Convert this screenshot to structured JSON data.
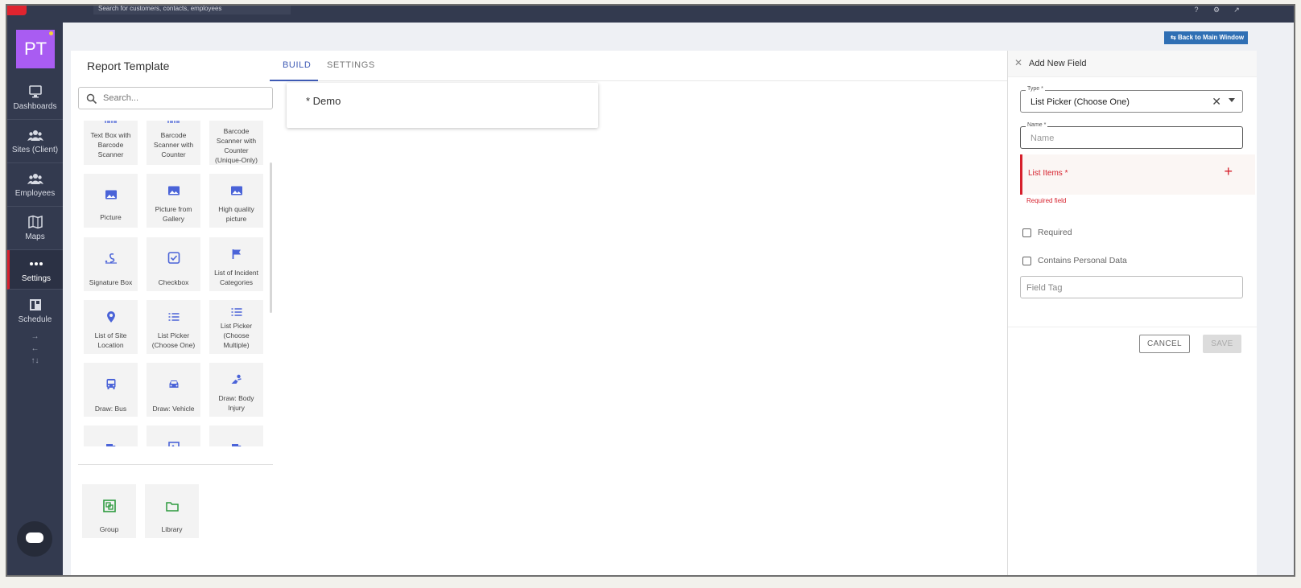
{
  "topbar": {
    "search_placeholder": "Search for customers, contacts, employees"
  },
  "sidebar": {
    "avatar_initials": "PT",
    "items": [
      {
        "label": "Dashboards",
        "icon": "monitor-icon"
      },
      {
        "label": "Sites (Client)",
        "icon": "group-icon"
      },
      {
        "label": "Employees",
        "icon": "people-icon"
      },
      {
        "label": "Maps",
        "icon": "map-icon"
      },
      {
        "label": "Settings",
        "icon": "more-dots-icon",
        "active": true
      },
      {
        "label": "Schedule",
        "icon": "schedule-icon"
      }
    ],
    "small_icons": [
      "→",
      "←",
      "↑↓"
    ]
  },
  "header": {
    "back_button": "Back to Main Window"
  },
  "builder": {
    "title": "Report Template",
    "tabs": [
      {
        "label": "BUILD",
        "active": true
      },
      {
        "label": "SETTINGS",
        "active": false
      }
    ],
    "search_placeholder": "Search...",
    "tiles": [
      {
        "label": "Text Box with Barcode Scanner",
        "icon": "barcode-icon"
      },
      {
        "label": "Barcode Scanner with Counter",
        "icon": "barcode-icon"
      },
      {
        "label": "Barcode Scanner with Counter (Unique-Only)",
        "icon": "barcode-icon"
      },
      {
        "label": "Picture",
        "icon": "image-icon"
      },
      {
        "label": "Picture from Gallery",
        "icon": "image-icon"
      },
      {
        "label": "High quality picture",
        "icon": "image-icon"
      },
      {
        "label": "Signature Box",
        "icon": "signature-icon"
      },
      {
        "label": "Checkbox",
        "icon": "checkbox-icon"
      },
      {
        "label": "List of Incident Categories",
        "icon": "flag-icon"
      },
      {
        "label": "List of Site Location",
        "icon": "location-pin-icon"
      },
      {
        "label": "List Picker (Choose One)",
        "icon": "list-icon"
      },
      {
        "label": "List Picker (Choose Multiple)",
        "icon": "list-icon"
      },
      {
        "label": "Draw: Bus",
        "icon": "bus-icon"
      },
      {
        "label": "Draw: Vehicle",
        "icon": "car-icon"
      },
      {
        "label": "Draw: Body Injury",
        "icon": "body-injury-icon"
      }
    ],
    "extra_tiles": [
      {
        "label": "Group",
        "icon": "group-box-icon"
      },
      {
        "label": "Library",
        "icon": "folder-icon"
      }
    ],
    "form_name": "* Demo"
  },
  "panel": {
    "title": "Add New Field",
    "type_label": "Type *",
    "type_value": "List Picker (Choose One)",
    "name_label": "Name *",
    "name_placeholder": "Name",
    "list_items_label": "List Items *",
    "required_error": "Required field",
    "required_checkbox": "Required",
    "personal_data_checkbox": "Contains Personal Data",
    "field_tag_placeholder": "Field Tag",
    "cancel_label": "CANCEL",
    "save_label": "SAVE"
  },
  "colors": {
    "sidebar_bg": "#333a4f",
    "accent_blue": "#3f5bb5",
    "icon_blue": "#4a63d8",
    "error_red": "#d6202c",
    "avatar_purple": "#a95cf2",
    "group_green": "#2c9a3e"
  }
}
